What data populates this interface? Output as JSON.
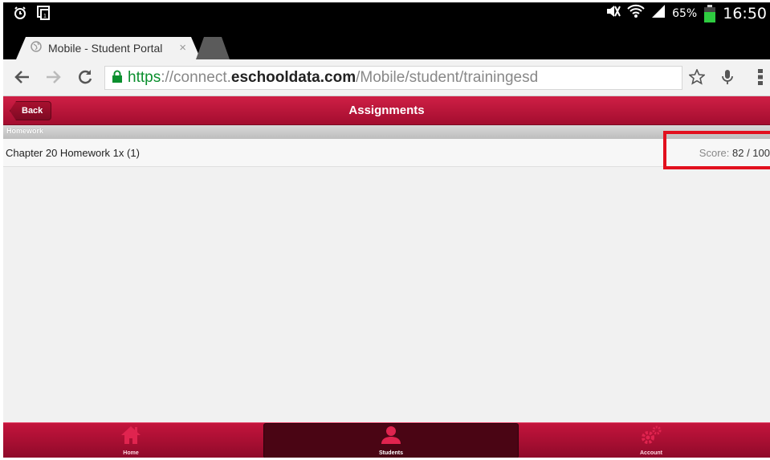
{
  "status_bar": {
    "battery_percent": "65%",
    "time": "16:50"
  },
  "browser": {
    "tab_title": "Mobile - Student Portal",
    "url": {
      "scheme": "https",
      "sep": "://",
      "pre": "connect.",
      "host": "eschooldata.com",
      "path": "/Mobile/student/trainingesd"
    }
  },
  "header": {
    "back_label": "Back",
    "title": "Assignments"
  },
  "section": {
    "label": "Homework"
  },
  "assignments": [
    {
      "name": "Chapter 20 Homework 1x (1)",
      "score_label": "Score:",
      "score_value": "82 / 100"
    }
  ],
  "bottom_nav": [
    {
      "label": "Home",
      "icon": "home-icon"
    },
    {
      "label": "Students",
      "icon": "student-icon",
      "active": true
    },
    {
      "label": "Account",
      "icon": "gears-icon"
    }
  ],
  "colors": {
    "brand": "#b3123a",
    "highlight": "#e2101e",
    "secure": "#0b8f2e"
  }
}
